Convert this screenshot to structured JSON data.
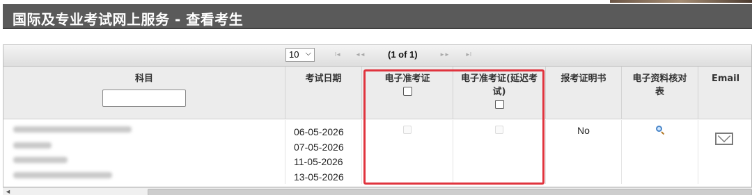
{
  "page": {
    "title": "国际及专业考试网上服务 - 查看考生"
  },
  "pager": {
    "rows_per_page": "10",
    "first_icon": "►I",
    "prev_icon": "◄◄",
    "page_info": "(1 of 1)",
    "next_icon": "►►",
    "last_icon": "►I"
  },
  "columns": {
    "subject": "科目",
    "exam_date": "考试日期",
    "e_admission": "电子准考证",
    "e_admission_delayed": "电子准考证(延迟考试)",
    "entry_certificate": "报考证明书",
    "e_verification": "电子资料核对表",
    "email": "Email"
  },
  "row": {
    "exam_dates": [
      "06-05-2026",
      "07-05-2026",
      "11-05-2026",
      "13-05-2026"
    ],
    "entry_certificate": "No"
  },
  "icons": {
    "view": "search-icon",
    "email": "mail-icon"
  },
  "colors": {
    "title_bar": "#5a5a5a",
    "highlight": "#e0343e"
  }
}
